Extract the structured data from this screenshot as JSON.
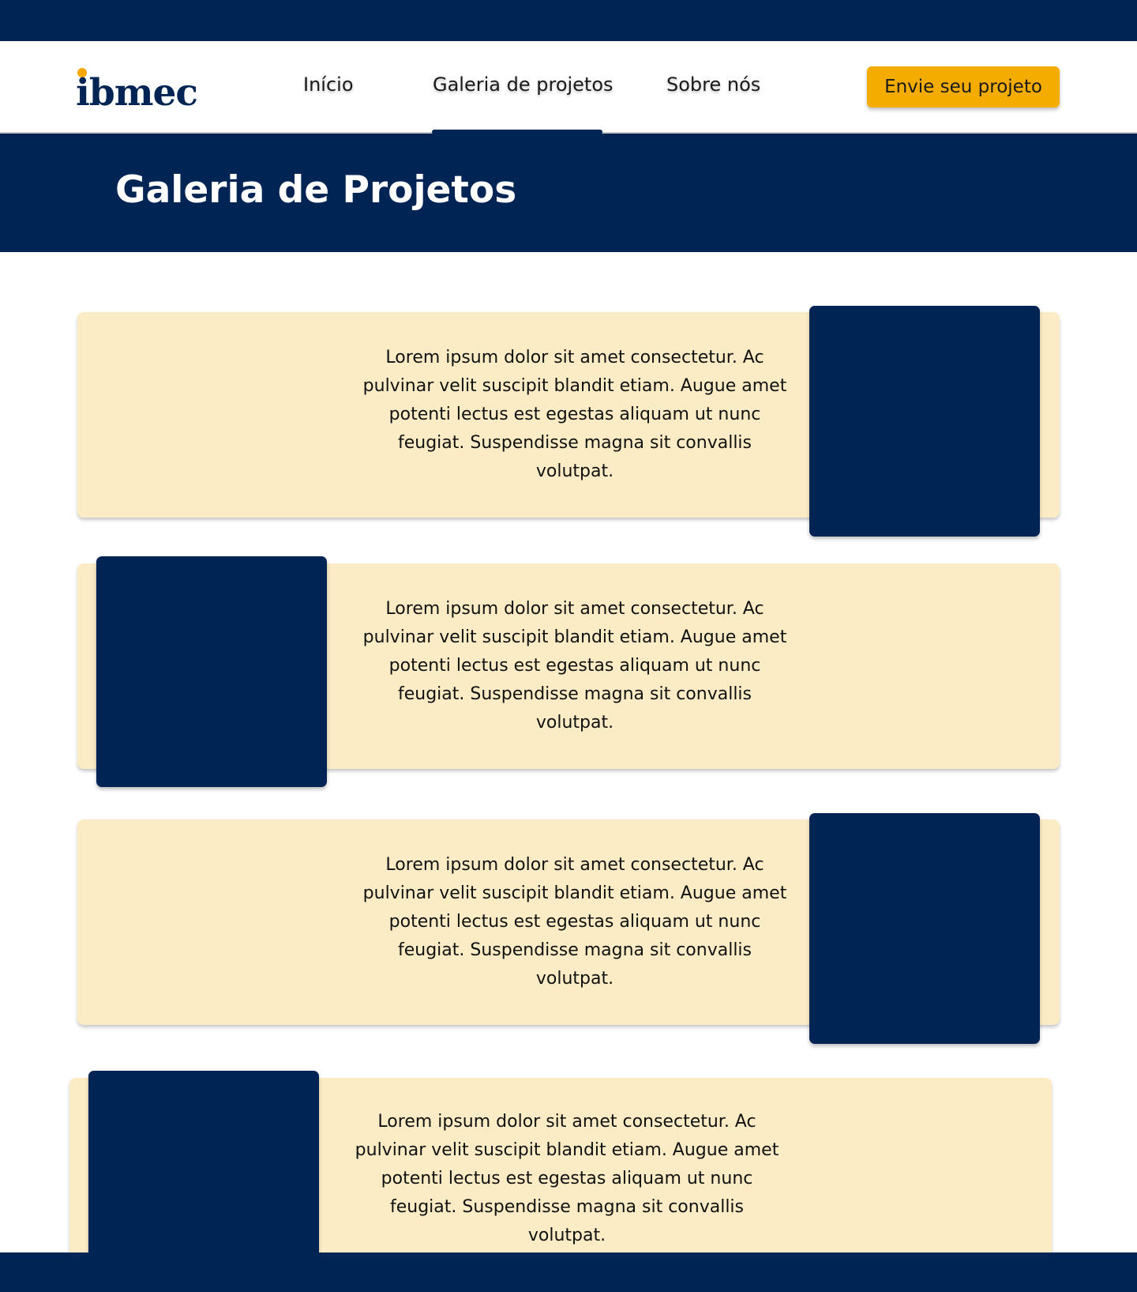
{
  "brand": {
    "logo_text": "ibmec",
    "accent": "#f5a800",
    "primary": "#002454"
  },
  "nav": {
    "items": [
      {
        "label": "Início",
        "active": false
      },
      {
        "label": "Galeria de projetos",
        "active": true
      },
      {
        "label": "Sobre nós",
        "active": false
      }
    ],
    "cta_label": "Envie seu projeto",
    "cta_color": "#f5ac00"
  },
  "hero": {
    "title": "Galeria de Projetos"
  },
  "projects": [
    {
      "description": "Lorem ipsum dolor sit amet consectetur. Ac pulvinar velit suscipit blandit etiam. Augue amet potenti lectus est egestas aliquam ut nunc feugiat. Suspendisse magna sit convallis volutpat."
    },
    {
      "description": "Lorem ipsum dolor sit amet consectetur. Ac pulvinar velit suscipit blandit etiam. Augue amet potenti lectus est egestas aliquam ut nunc feugiat. Suspendisse magna sit convallis volutpat."
    },
    {
      "description": "Lorem ipsum dolor sit amet consectetur. Ac pulvinar velit suscipit blandit etiam. Augue amet potenti lectus est egestas aliquam ut nunc feugiat. Suspendisse magna sit convallis volutpat."
    },
    {
      "description": "Lorem ipsum dolor sit amet consectetur. Ac pulvinar velit suscipit blandit etiam. Augue amet potenti lectus est egestas aliquam ut nunc feugiat. Suspendisse magna sit convallis volutpat."
    }
  ],
  "colors": {
    "card_bg": "#fcecc6",
    "image_placeholder": "#002454"
  }
}
